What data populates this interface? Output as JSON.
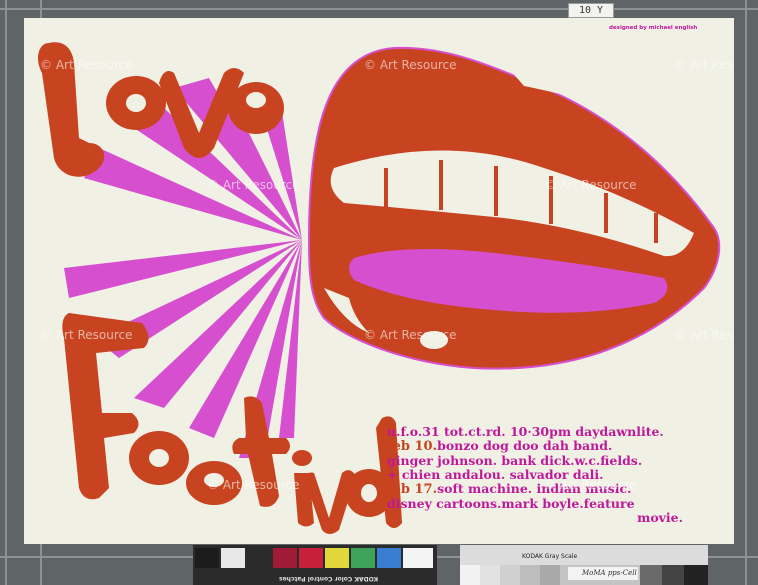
{
  "tag_label": "10 Y",
  "poster": {
    "designer_credit": "designed by michael english",
    "listing": {
      "line1": "u.f.o.31 tot.ct.rd. 10·30pm daydawnlite.",
      "date2": "feb 10.",
      "line2": "bonzo dog doo dah band.",
      "line3": "ginger johnson. bank dick.w.c.fields.",
      "line4": "+ chien andalou. salvador dali.",
      "date5": "feb 17.",
      "line5": "soft machine. indian music.",
      "line6": "disney cartoons.mark boyle.feature",
      "line7": "movie."
    },
    "colors": {
      "red": "#c8431f",
      "magenta": "#d64fcf",
      "cream": "#f0f0e4"
    }
  },
  "watermark": "© Art Resource",
  "colorbar_label": "KODAK Color Control Patches",
  "graybar": {
    "label": "KODAK Gray Scale",
    "handwritten": "MoMA pps-Cell"
  }
}
